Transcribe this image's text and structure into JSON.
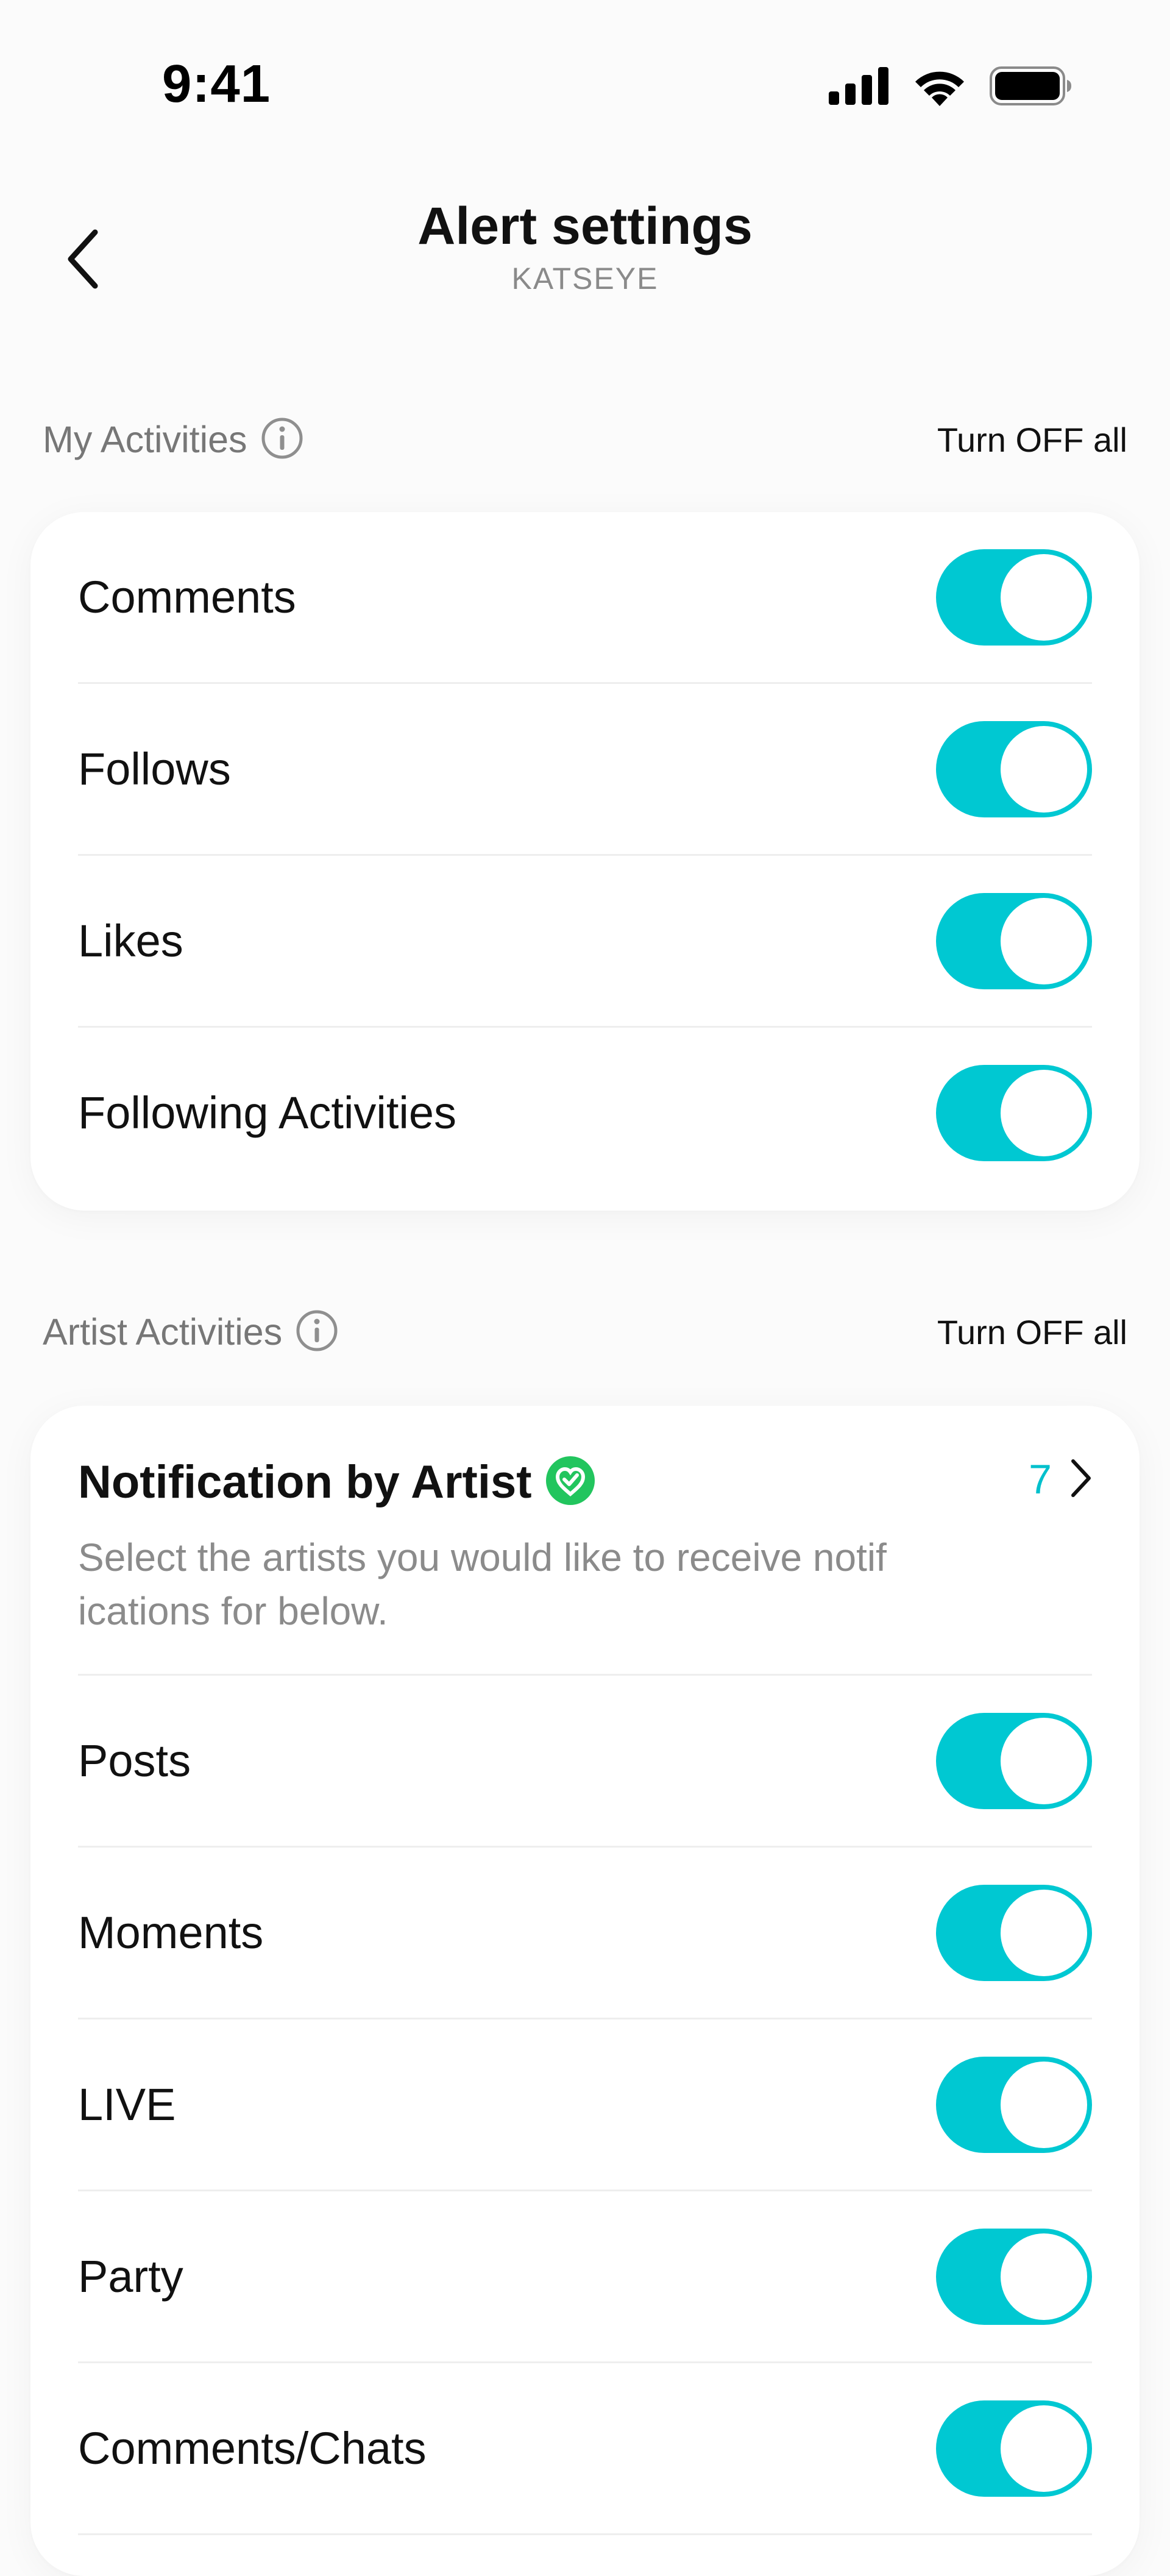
{
  "status_bar": {
    "time": "9:41"
  },
  "header": {
    "title": "Alert settings",
    "subtitle": "KATSEYE"
  },
  "my_activities": {
    "title": "My Activities",
    "turn_off_all": "Turn OFF all",
    "items": [
      {
        "label": "Comments",
        "enabled": true
      },
      {
        "label": "Follows",
        "enabled": true
      },
      {
        "label": "Likes",
        "enabled": true
      },
      {
        "label": "Following Activities",
        "enabled": true
      }
    ]
  },
  "artist_activities": {
    "title": "Artist Activities",
    "turn_off_all": "Turn OFF all",
    "notification_by_artist": {
      "title": "Notification by Artist",
      "count": "7",
      "description": "Select the artists you would like to receive notif ications for below."
    },
    "items": [
      {
        "label": "Posts",
        "enabled": true
      },
      {
        "label": "Moments",
        "enabled": true
      },
      {
        "label": "LIVE",
        "enabled": true
      },
      {
        "label": "Party",
        "enabled": true
      },
      {
        "label": "Comments/Chats",
        "enabled": true
      }
    ]
  },
  "colors": {
    "accent": "#00c8d2",
    "verified_badge": "#22c55e",
    "secondary_text": "#8a8a8a"
  },
  "icons": [
    "cellular-signal-icon",
    "wifi-icon",
    "battery-icon",
    "back-chevron-icon",
    "info-icon",
    "verified-badge-icon",
    "chevron-right-icon"
  ]
}
